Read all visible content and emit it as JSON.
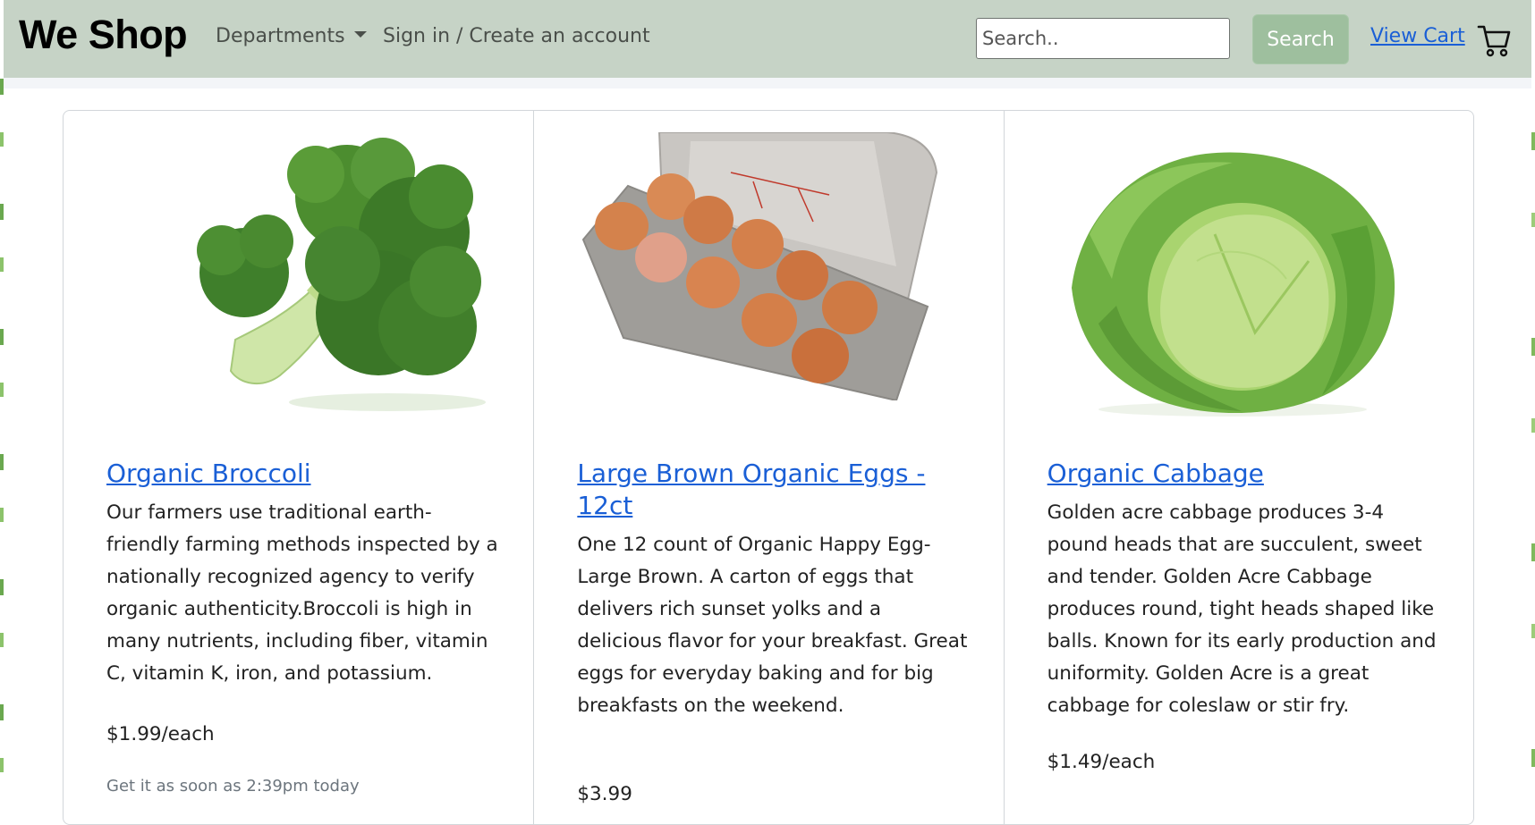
{
  "header": {
    "brand": "We Shop",
    "departments_label": "Departments",
    "signin_label": "Sign in / Create an account",
    "search": {
      "placeholder": "Search..",
      "value": ""
    },
    "search_button": "Search",
    "view_cart": "View Cart",
    "cart_icon": "shopping-cart-icon"
  },
  "products": [
    {
      "image_icon": "broccoli-image",
      "title": "Organic Broccoli",
      "description": "Our farmers use traditional earth-friendly farming methods inspected by a nationally recognized agency to verify organic authenticity.Broccoli is high in many nutrients, including fiber, vitamin C, vitamin K, iron, and potassium.",
      "price": "$1.99/each",
      "delivery": "Get it as soon as 2:39pm today"
    },
    {
      "image_icon": "egg-carton-image",
      "title": "Large Brown Organic Eggs - 12ct",
      "description": "One 12 count of Organic Happy Egg- Large Brown. A carton of eggs that delivers rich sunset yolks and a delicious flavor for your breakfast. Great eggs for everyday baking and for big breakfasts on the weekend.",
      "price": "$3.99"
    },
    {
      "image_icon": "cabbage-image",
      "title": "Organic Cabbage",
      "description": "Golden acre cabbage produces 3-4 pound heads that are succulent, sweet and tender. Golden Acre Cabbage produces round, tight heads shaped like balls. Known for its early production and uniformity. Golden Acre is a great cabbage for coleslaw or stir fry.",
      "price": "$1.49/each"
    }
  ],
  "colors": {
    "navbar_bg": "#c6d3c6",
    "search_button_bg": "#9ebf9e",
    "link": "#1a5fd6"
  }
}
